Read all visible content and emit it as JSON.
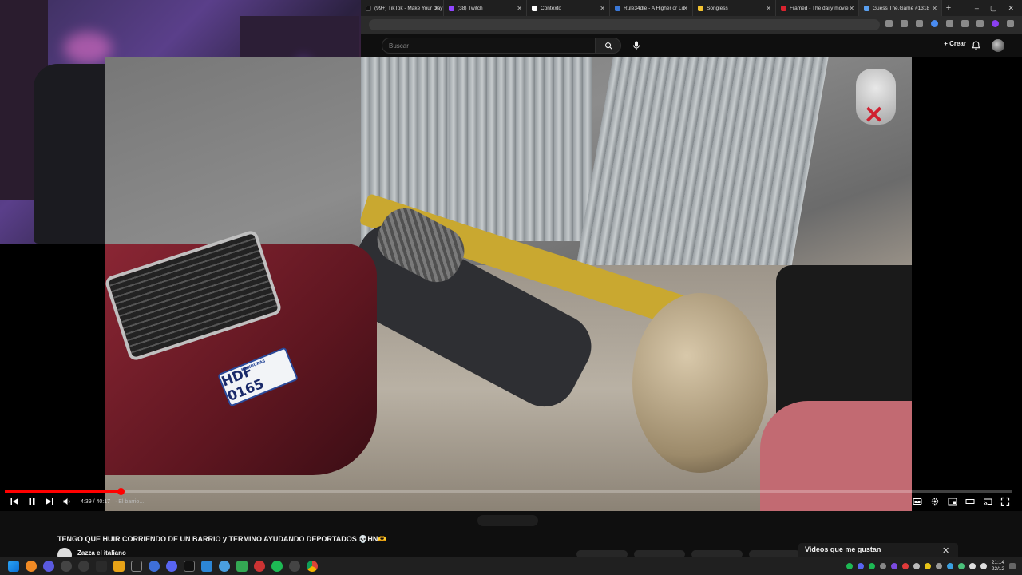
{
  "browser": {
    "tabs": [
      {
        "label": "(99+) TikTok - Make Your Day",
        "color": "#111111",
        "active": false
      },
      {
        "label": "(38) Twitch",
        "color": "#9146ff",
        "active": false
      },
      {
        "label": "Contexto",
        "color": "#ffffff",
        "active": false
      },
      {
        "label": "Rule34dle - A Higher or Lo",
        "color": "#3a78d8",
        "active": false
      },
      {
        "label": "Songless",
        "color": "#f2c230",
        "active": false
      },
      {
        "label": "Framed - The daily movie",
        "color": "#d9232e",
        "active": false
      },
      {
        "label": "Guess The.Game #1318",
        "color": "#5aa0f0",
        "active": true
      }
    ],
    "new_tab": "+",
    "window_controls": [
      "–",
      "▢",
      "✕"
    ]
  },
  "youtube": {
    "search_placeholder": "Buscar",
    "create_label": "Crear",
    "icons": {
      "search": "search-icon",
      "mic": "mic-icon",
      "bell": "bell-icon",
      "plus": "plus-icon"
    }
  },
  "video": {
    "plate_text": "HDF 0165",
    "plate_country": "HONDURAS",
    "current_time": "4:39",
    "duration": "40:17",
    "time_display": "4:39 / 40:17",
    "chapter": "· El barrio...",
    "progress_fraction": 0.115,
    "title": "TENGO QUE HUIR CORRIENDO DE UN BARRIO y TERMINO AYUDANDO DEPORTADOS 💀HN🫶",
    "channel": "Zazza el italiano",
    "colors": {
      "progress": "#ff0000"
    }
  },
  "side_panel": {
    "title": "Videos que me gustan",
    "close": "✕"
  },
  "taskbar": {
    "time": "21:14",
    "date": "22/12"
  }
}
